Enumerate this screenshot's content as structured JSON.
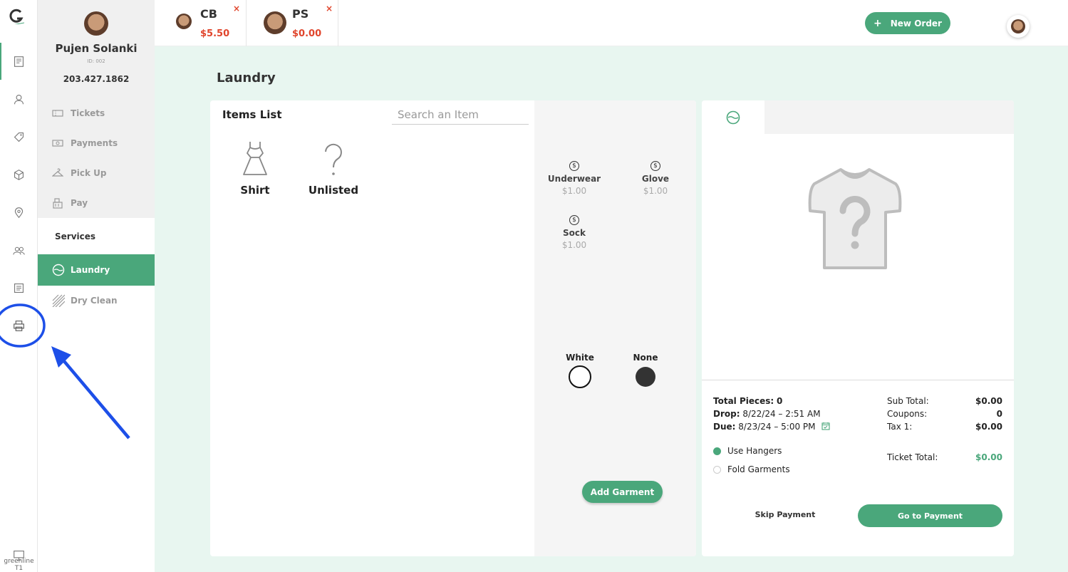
{
  "rail": {
    "icons": [
      "receipt-icon",
      "person-icon",
      "tag-icon",
      "box-icon",
      "location-pin-icon",
      "group-icon",
      "list-icon",
      "printer-icon"
    ],
    "footer_text": "greenline T1"
  },
  "customer": {
    "name": "Pujen Solanki",
    "id": "ID: 002",
    "phone": "203.427.1862"
  },
  "sidebar": {
    "nav": [
      {
        "label": "Tickets",
        "icon": "ticket-icon"
      },
      {
        "label": "Payments",
        "icon": "cash-icon"
      },
      {
        "label": "Pick Up",
        "icon": "hanger-icon"
      },
      {
        "label": "Pay",
        "icon": "register-icon"
      }
    ],
    "services_label": "Services",
    "services": [
      {
        "label": "Laundry",
        "icon": "washer-icon",
        "active": true
      },
      {
        "label": "Dry Clean",
        "icon": "stripes-icon",
        "active": false
      }
    ]
  },
  "tabs": [
    {
      "name": "CB",
      "price": "$5.50",
      "close": "×"
    },
    {
      "name": "PS",
      "price": "$0.00",
      "close": "×"
    }
  ],
  "header": {
    "new_order_plus": "+",
    "new_order_label": "New Order"
  },
  "page": {
    "title": "Laundry"
  },
  "items": {
    "title": "Items List",
    "search_placeholder": "Search an Item",
    "list": [
      {
        "label": "Shirt",
        "icon": "dress-icon"
      },
      {
        "label": "Unlisted",
        "icon": "question-mark-icon"
      }
    ]
  },
  "sub_items": {
    "coin_symbol": "$",
    "list": [
      {
        "name": "Underwear",
        "price": "$1.00"
      },
      {
        "name": "Glove",
        "price": "$1.00"
      },
      {
        "name": "Sock",
        "price": "$1.00"
      }
    ]
  },
  "colors": [
    {
      "name": "White",
      "hex": "#ffffff"
    },
    {
      "name": "None",
      "hex": "#333333"
    }
  ],
  "add_garment_label": "Add Garment",
  "ticket": {
    "tab_icon": "washer-icon",
    "placeholder_icon": "shirt-question-icon",
    "total_pieces_label": "Total Pieces:",
    "total_pieces": "0",
    "drop_label": "Drop:",
    "drop_value": "8/22/24 – 2:51 AM",
    "due_label": "Due:",
    "due_value": "8/23/24 – 5:00 PM",
    "sub_total_label": "Sub Total:",
    "sub_total": "$0.00",
    "coupons_label": "Coupons:",
    "coupons": "0",
    "tax_label": "Tax 1:",
    "tax": "$0.00",
    "ticket_total_label": "Ticket Total:",
    "ticket_total": "$0.00",
    "options": [
      {
        "label": "Use Hangers",
        "selected": true
      },
      {
        "label": "Fold Garments",
        "selected": false
      }
    ],
    "skip_label": "Skip Payment",
    "go_label": "Go to Payment"
  },
  "colors_theme": {
    "accent": "#4aa77b",
    "danger": "#e0452c",
    "annotation": "#1d4fe8"
  }
}
